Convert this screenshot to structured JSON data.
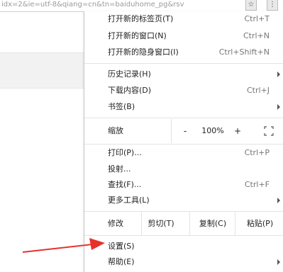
{
  "browser": {
    "url_fragment": "idx=2&ie=utf-8&qiang=cn&tn=baiduhome_pg&rsv",
    "star_icon": "star-icon",
    "menu_icon": "kebab-menu-icon"
  },
  "menu": {
    "new_tab": {
      "label": "打开新的标签页(T)",
      "shortcut": "Ctrl+T"
    },
    "new_window": {
      "label": "打开新的窗口(N)",
      "shortcut": "Ctrl+N"
    },
    "incognito": {
      "label": "打开新的隐身窗口(I)",
      "shortcut": "Ctrl+Shift+N"
    },
    "history": {
      "label": "历史记录(H)"
    },
    "downloads": {
      "label": "下载内容(D)",
      "shortcut": "Ctrl+J"
    },
    "bookmarks": {
      "label": "书签(B)"
    },
    "zoom": {
      "label": "缩放",
      "minus": "-",
      "value": "100%",
      "plus": "+"
    },
    "print": {
      "label": "打印(P)...",
      "shortcut": "Ctrl+P"
    },
    "cast": {
      "label": "投射..."
    },
    "find": {
      "label": "查找(F)...",
      "shortcut": "Ctrl+F"
    },
    "more_tools": {
      "label": "更多工具(L)"
    },
    "edit": {
      "label": "修改",
      "cut": "剪切(T)",
      "copy": "复制(C)",
      "paste": "粘贴(P)"
    },
    "settings": {
      "label": "设置(S)"
    },
    "help": {
      "label": "帮助(E)"
    }
  },
  "annotation": {
    "color": "#e8312a"
  }
}
